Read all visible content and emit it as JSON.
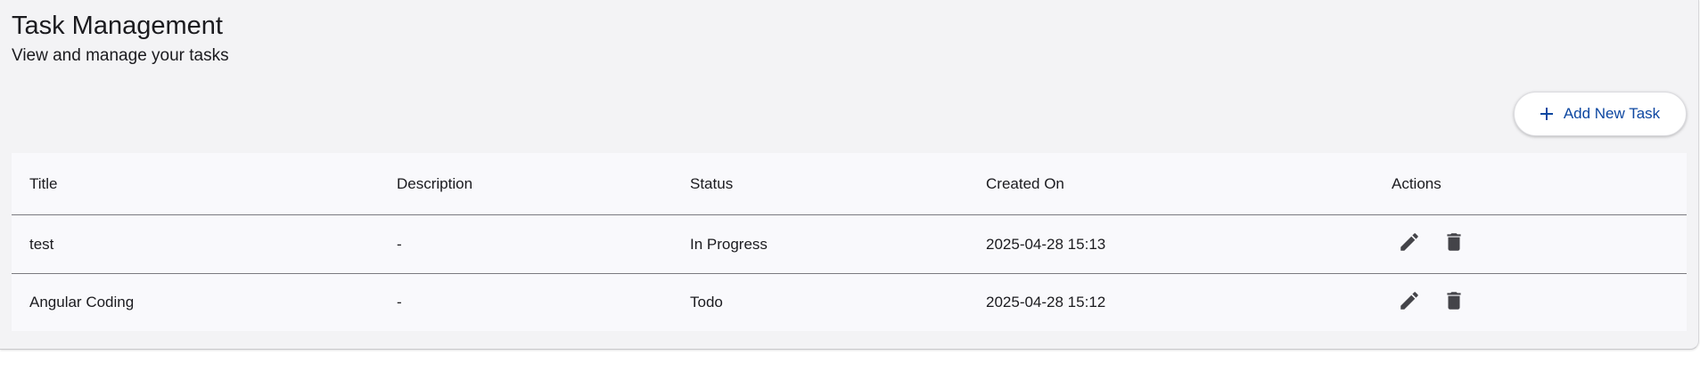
{
  "page": {
    "title": "Task Management",
    "subtitle": "View and manage your tasks"
  },
  "toolbar": {
    "add_label": "Add New Task",
    "add_icon": "plus-icon"
  },
  "table": {
    "columns": [
      "Title",
      "Description",
      "Status",
      "Created On",
      "Actions"
    ],
    "rows": [
      {
        "title": "test",
        "description": "-",
        "status": "In Progress",
        "created_on": "2025-04-28 15:13"
      },
      {
        "title": "Angular Coding",
        "description": "-",
        "status": "Todo",
        "created_on": "2025-04-28 15:12"
      }
    ],
    "row_actions": [
      "pencil-icon",
      "trash-icon"
    ]
  },
  "colors": {
    "background": "#f3f3f5",
    "accent": "#0d47a1",
    "icon": "#444449"
  }
}
